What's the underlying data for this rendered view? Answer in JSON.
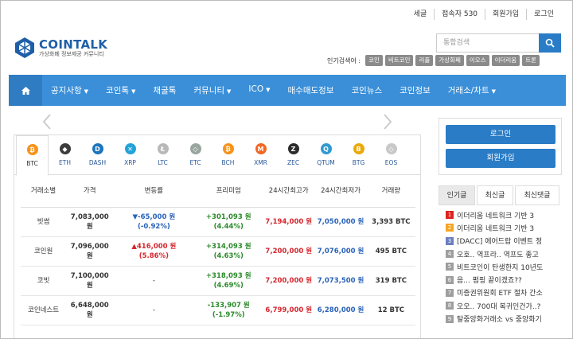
{
  "top_links": [
    "세글",
    "접속자 530",
    "회원가입",
    "로그인"
  ],
  "logo": {
    "title": "COINTALK",
    "subtitle": "가상화폐 정보제공 커뮤니티"
  },
  "search": {
    "placeholder": "통합검색"
  },
  "popular": {
    "label": "인기검색어 :",
    "tags": [
      "코인",
      "비트코인",
      "리플",
      "가상화폐",
      "이오스",
      "이더리움",
      "트론"
    ]
  },
  "nav": [
    {
      "label": "공지사항",
      "caret": true
    },
    {
      "label": "코인톡",
      "caret": true
    },
    {
      "label": "채굴톡",
      "caret": false
    },
    {
      "label": "커뮤니티",
      "caret": true
    },
    {
      "label": "ICO",
      "caret": true
    },
    {
      "label": "매수매도정보",
      "caret": false
    },
    {
      "label": "코인뉴스",
      "caret": false
    },
    {
      "label": "코인정보",
      "caret": false
    },
    {
      "label": "거래소/차트",
      "caret": true
    }
  ],
  "coin_tabs": [
    {
      "label": "BTC",
      "color": "#f7931a",
      "glyph": "₿"
    },
    {
      "label": "ETH",
      "color": "#3c3c3d",
      "glyph": "◆"
    },
    {
      "label": "DASH",
      "color": "#1c75bc",
      "glyph": "D"
    },
    {
      "label": "XRP",
      "color": "#23a3d9",
      "glyph": "✕"
    },
    {
      "label": "LTC",
      "color": "#b8b8b8",
      "glyph": "Ł"
    },
    {
      "label": "ETC",
      "color": "#9aa5a0",
      "glyph": "◇"
    },
    {
      "label": "BCH",
      "color": "#f7931a",
      "glyph": "₿"
    },
    {
      "label": "XMR",
      "color": "#f26822",
      "glyph": "M"
    },
    {
      "label": "ZEC",
      "color": "#2b2b2b",
      "glyph": "Z"
    },
    {
      "label": "QTUM",
      "color": "#2e9ad0",
      "glyph": "Q"
    },
    {
      "label": "BTG",
      "color": "#eba809",
      "glyph": "B"
    },
    {
      "label": "EOS",
      "color": "#c8c8c8",
      "glyph": "◇"
    }
  ],
  "table": {
    "headers": [
      "거래소별",
      "가격",
      "변동률",
      "프리미엄",
      "24시간최고가",
      "24시간최저가",
      "거래량"
    ],
    "rows": [
      {
        "name": "빗썸",
        "price": "7,083,000 원",
        "change": "▼-65,000 원 (-0.92%)",
        "change_dir": "down",
        "premium": "+301,093 원 (4.44%)",
        "high": "7,194,000 원",
        "low": "7,050,000 원",
        "volume": "3,393 BTC"
      },
      {
        "name": "코인원",
        "price": "7,096,000 원",
        "change": "▲416,000 원 (5.86%)",
        "change_dir": "up",
        "premium": "+314,093 원 (4.63%)",
        "high": "7,200,000 원",
        "low": "7,076,000 원",
        "volume": "495 BTC"
      },
      {
        "name": "코빗",
        "price": "7,100,000 원",
        "change": "-",
        "change_dir": "none",
        "premium": "+318,093 원 (4.69%)",
        "high": "7,200,000 원",
        "low": "7,073,500 원",
        "volume": "319 BTC"
      },
      {
        "name": "코인네스트",
        "price": "6,648,000 원",
        "change": "-",
        "change_dir": "none",
        "premium": "-133,907 원 (-1.97%)",
        "high": "6,799,000 원",
        "low": "6,280,000 원",
        "volume": "12 BTC"
      }
    ]
  },
  "side": {
    "login": "로그인",
    "join": "회원가입"
  },
  "side_tabs": [
    "인기글",
    "최신글",
    "최신댓글"
  ],
  "news": [
    {
      "num": "1",
      "color": "#e02020",
      "text": "이더리움 네트워크 기반 3"
    },
    {
      "num": "2",
      "color": "#f5a623",
      "text": "이더리움 네트워크 기반 3"
    },
    {
      "num": "3",
      "color": "#6b7fc0",
      "text": "[DACC] 에어드랍 이벤트 정"
    },
    {
      "num": "4",
      "color": "#9e9e9e",
      "text": "오호.. 역프라.. 역프도 좋고"
    },
    {
      "num": "5",
      "color": "#9e9e9e",
      "text": "비트코인이 탄생한지 10년도"
    },
    {
      "num": "6",
      "color": "#9e9e9e",
      "text": "음... 펌핑 끝이겠죠??"
    },
    {
      "num": "7",
      "color": "#9e9e9e",
      "text": "미증권위원회 ETF 절차 간소"
    },
    {
      "num": "8",
      "color": "#9e9e9e",
      "text": "오오.. 700대 복귀인건가..?"
    },
    {
      "num": "9",
      "color": "#9e9e9e",
      "text": "탈중앙화거래소 vs 중앙화기"
    }
  ]
}
